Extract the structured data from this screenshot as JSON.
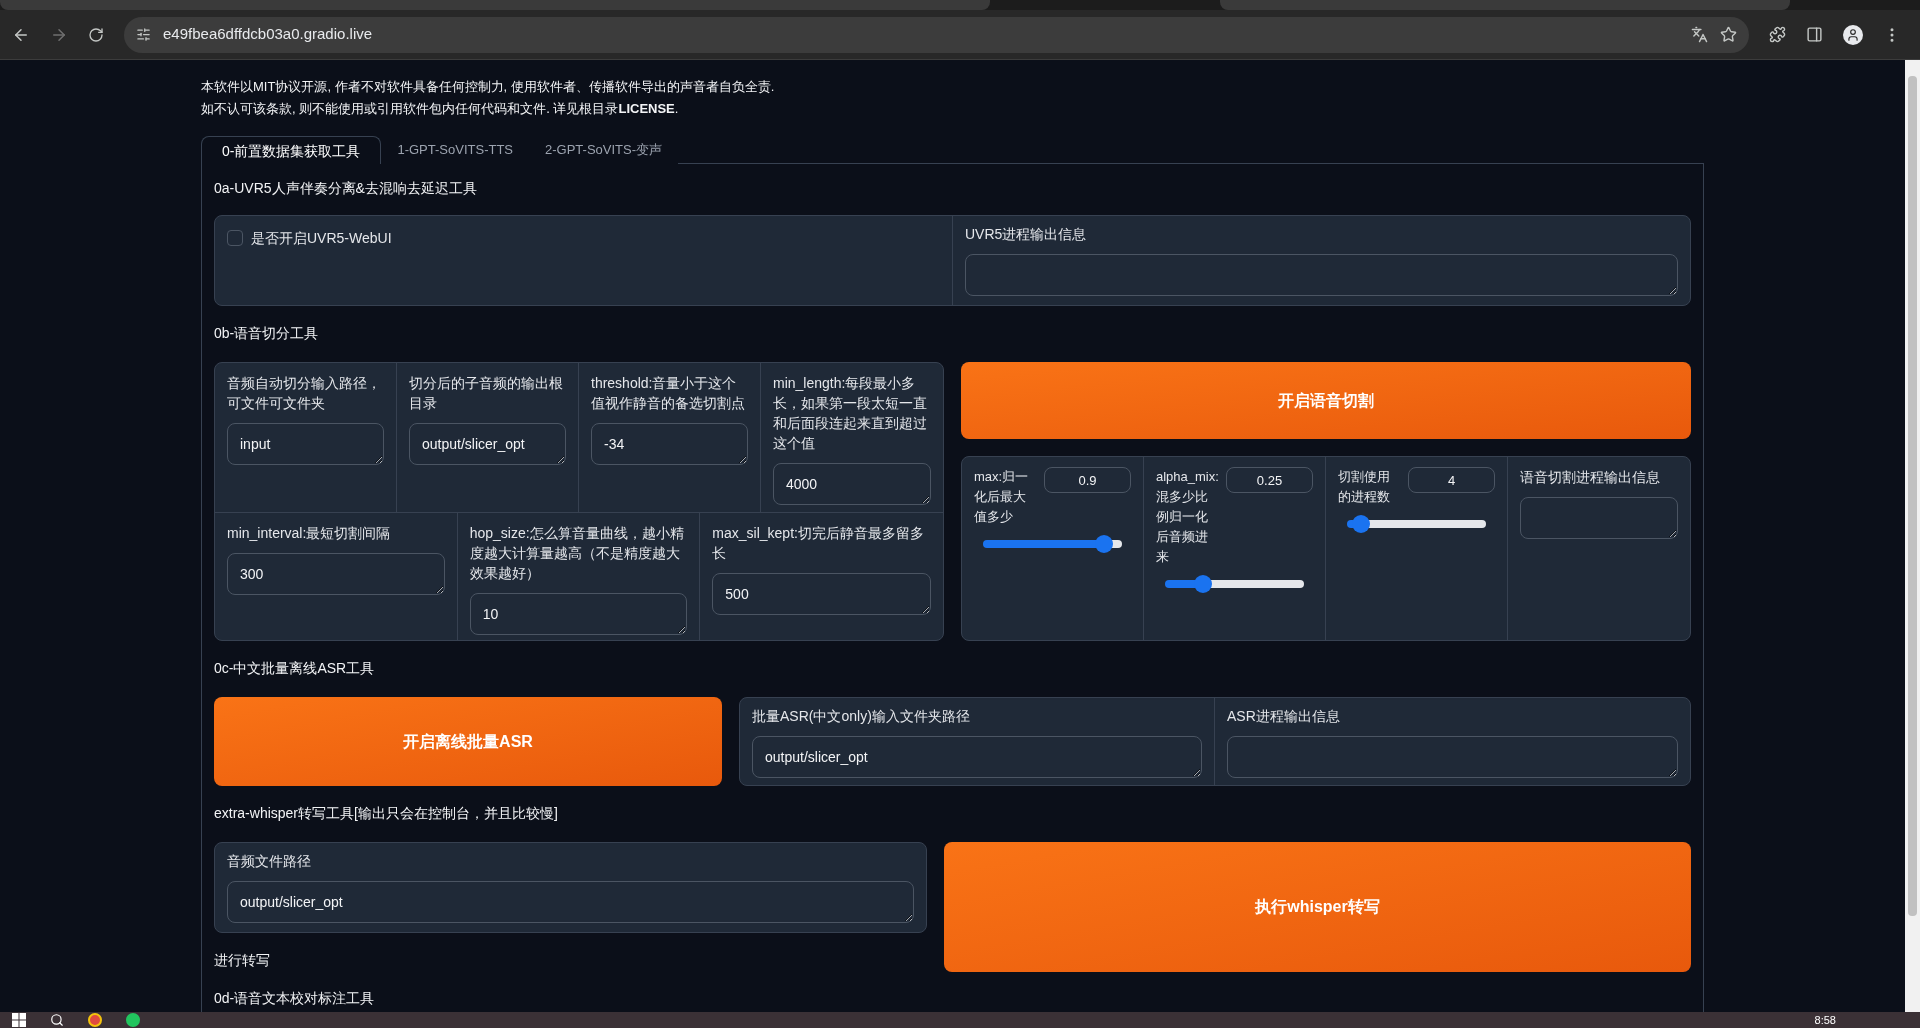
{
  "browser": {
    "url": "e49fbea6dffdcb03a0.gradio.live"
  },
  "notice": [
    "本软件以MIT协议开源, 作者不对软件具备任何控制力, 使用软件者、传播软件导出的声音者自负全责.",
    "如不认可该条款, 则不能使用或引用软件包内任何代码和文件. 详见根目录**LICENSE**."
  ],
  "tabs": [
    {
      "label": "0-前置数据集获取工具",
      "selected": true
    },
    {
      "label": "1-GPT-SoVITS-TTS",
      "selected": false
    },
    {
      "label": "2-GPT-SoVITS-变声",
      "selected": false
    }
  ],
  "uvr5": {
    "title": "0a-UVR5人声伴奏分离&去混响去延迟工具",
    "checkbox": {
      "label": "是否开启UVR5-WebUI",
      "checked": false
    },
    "output": {
      "label": "UVR5进程输出信息"
    }
  },
  "slicer": {
    "title": "0b-语音切分工具",
    "fields_row1": [
      {
        "label": "音频自动切分输入路径，可文件可文件夹",
        "value": "input"
      },
      {
        "label": "切分后的子音频的输出根目录",
        "value": "output/slicer_opt"
      },
      {
        "label": "threshold:音量小于这个值视作静音的备选切割点",
        "value": "-34"
      },
      {
        "label": "min_length:每段最小多长，如果第一段太短一直和后面段连起来直到超过这个值",
        "value": "4000"
      }
    ],
    "fields_row2": [
      {
        "label": "min_interval:最短切割间隔",
        "value": "300"
      },
      {
        "label": "hop_size:怎么算音量曲线，越小精度越大计算量越高（不是精度越大效果越好）",
        "value": "10"
      },
      {
        "label": "max_sil_kept:切完后静音最多留多长",
        "value": "500"
      }
    ],
    "button": "开启语音切割",
    "sliders": [
      {
        "label": "max:归一化后最大值多少",
        "value": "0.9",
        "level": 0.87
      },
      {
        "label": "alpha_mix:混多少比例归一化后音频进来",
        "value": "0.25",
        "level": 0.27
      },
      {
        "label": "切割使用的进程数",
        "value": "4",
        "level": 0.1
      }
    ],
    "output": {
      "label": "语音切割进程输出信息"
    }
  },
  "asr": {
    "title": "0c-中文批量离线ASR工具",
    "button": "开启离线批量ASR",
    "input": {
      "label": "批量ASR(中文only)输入文件夹路径",
      "value": "output/slicer_opt"
    },
    "output": {
      "label": "ASR进程输出信息"
    }
  },
  "whisper": {
    "title": "extra-whisper转写工具[输出只会在控制台，并且比较慢]",
    "input": {
      "label": "音频文件路径",
      "value": "output/slicer_opt"
    },
    "button": "执行whisper转写",
    "note": "进行转写"
  },
  "next_section": {
    "title": "0d-语音文本校对标注工具"
  },
  "taskbar": {
    "time": "8:58"
  }
}
